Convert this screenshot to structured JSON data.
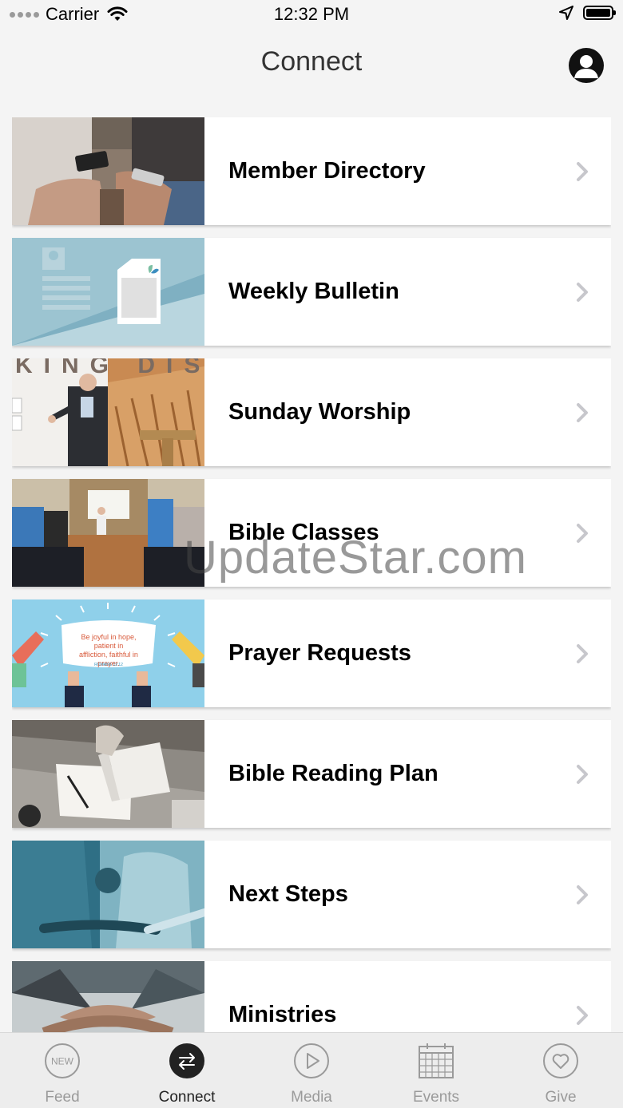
{
  "status_bar": {
    "carrier": "Carrier",
    "time": "12:32 PM"
  },
  "header": {
    "title": "Connect"
  },
  "items": [
    {
      "label": "Member Directory"
    },
    {
      "label": "Weekly Bulletin"
    },
    {
      "label": "Sunday Worship"
    },
    {
      "label": "Bible Classes"
    },
    {
      "label": "Prayer Requests"
    },
    {
      "label": "Bible Reading Plan"
    },
    {
      "label": "Next Steps"
    },
    {
      "label": "Ministries"
    }
  ],
  "thumb_text": {
    "worship_banner": "KING DIS",
    "verse": "Be joyful in hope, patient in affliction, faithful in prayer.",
    "verse_ref": "ROMANS 12:12"
  },
  "watermark": "UpdateStar.com",
  "tabs": [
    {
      "label": "Feed",
      "icon": "new-badge-icon",
      "badge": "NEW",
      "active": false
    },
    {
      "label": "Connect",
      "icon": "swap-arrows-icon",
      "active": true
    },
    {
      "label": "Media",
      "icon": "play-icon",
      "active": false
    },
    {
      "label": "Events",
      "icon": "calendar-icon",
      "active": false
    },
    {
      "label": "Give",
      "icon": "heart-icon",
      "active": false
    }
  ],
  "colors": {
    "active_tab": "#222222",
    "inactive_tab": "#9a9a9a",
    "background": "#f4f4f4"
  }
}
